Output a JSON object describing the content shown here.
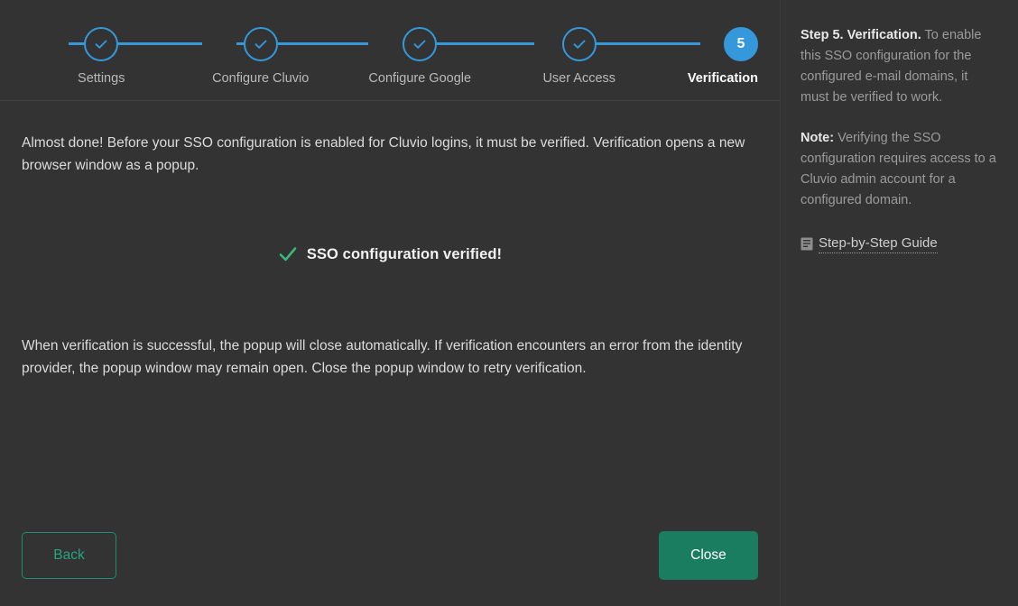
{
  "colors": {
    "background": "#333333",
    "accent_blue": "#3498db",
    "accent_green": "#1a7d60",
    "success_green": "#3cb878",
    "border": "#404040",
    "text_primary": "#dcdcdc",
    "text_muted": "#9b9b9b"
  },
  "stepper": {
    "steps": [
      {
        "number": "1",
        "label": "Settings",
        "state": "complete",
        "icon": "check-icon"
      },
      {
        "number": "2",
        "label": "Configure Cluvio",
        "state": "complete",
        "icon": "check-icon"
      },
      {
        "number": "3",
        "label": "Configure Google",
        "state": "complete",
        "icon": "check-icon"
      },
      {
        "number": "4",
        "label": "User Access",
        "state": "complete",
        "icon": "check-icon"
      },
      {
        "number": "5",
        "label": "Verification",
        "state": "active",
        "icon": ""
      }
    ]
  },
  "main": {
    "intro_paragraph": "Almost done! Before your SSO configuration is enabled for Cluvio logins, it must be verified. Verification opens a new browser window as a popup.",
    "status": {
      "icon": "check-icon",
      "text": "SSO configuration verified!"
    },
    "outro_paragraph": "When verification is successful, the popup will close automatically. If verification encounters an error from the identity provider, the popup window may remain open. Close the popup window to retry verification."
  },
  "footer": {
    "back_label": "Back",
    "close_label": "Close"
  },
  "sidebar": {
    "help_title": "Step 5. Verification.",
    "help_body": " To enable this SSO configuration for the configured e-mail domains, it must be verified to work.",
    "note_title": "Note:",
    "note_body": " Verifying the SSO configuration requires access to a Cluvio admin account for a configured domain.",
    "guide_link": {
      "icon": "book-icon",
      "label": "Step-by-Step Guide"
    }
  }
}
